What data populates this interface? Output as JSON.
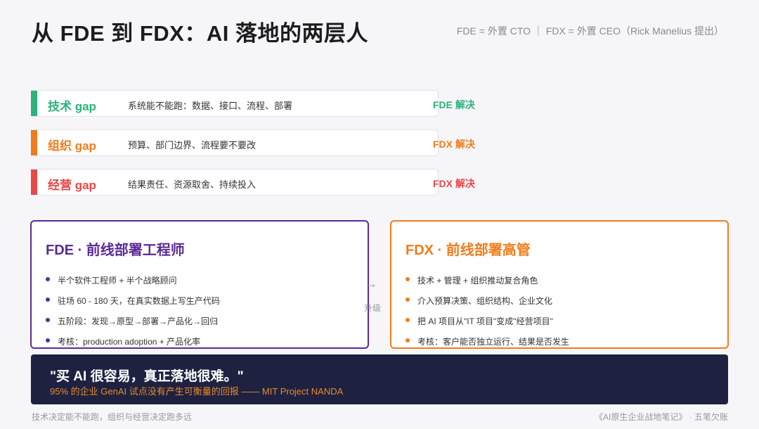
{
  "header": {
    "title": "从 FDE 到 FDX：AI 落地的两层人",
    "subtitle": "FDE = 外置 CTO ｜ FDX = 外置 CEO（Rick Manelius 提出）"
  },
  "gaps": [
    {
      "name": "技术 gap",
      "desc": "系统能不能跑：数据、接口、流程、部署",
      "solve": "FDE 解决",
      "color": "#2bb37a"
    },
    {
      "name": "组织 gap",
      "desc": "预算、部门边界、流程要不要改",
      "solve": "FDX 解决",
      "color": "#f07c1c"
    },
    {
      "name": "经营 gap",
      "desc": "结果责任、资源取舍、持续投入",
      "solve": "FDX 解决",
      "color": "#e84848"
    }
  ],
  "fde": {
    "title": "FDE · 前线部署工程师",
    "color": "#5b2a96",
    "items": [
      "半个软件工程师 + 半个战略顾问",
      "驻场 60 - 180 天，在真实数据上写生产代码",
      "五阶段：发现→原型→部署→产品化→回归",
      "考核：production adoption + 产品化率"
    ]
  },
  "fdx": {
    "title": "FDX · 前线部署高管",
    "color": "#f07c1c",
    "items": [
      "技术 + 管理 + 组织推动复合角色",
      "介入预算决策、组织结构、企业文化",
      "把 AI 项目从\"IT 项目\"变成\"经营项目\"",
      "考核：客户能否独立运行、结果是否发生"
    ]
  },
  "arrow": {
    "symbol": "→",
    "label": "升级"
  },
  "quote": {
    "text": "\"买 AI 很容易，真正落地很难。\"",
    "source": "95% 的企业 GenAI 试点没有产生可衡量的回报 —— MIT Project NANDA"
  },
  "footer": {
    "left": "技术决定能不能跑，组织与经营决定跑多远",
    "right": "《AI原生企业战地笔记》 · 五笔欠账"
  }
}
